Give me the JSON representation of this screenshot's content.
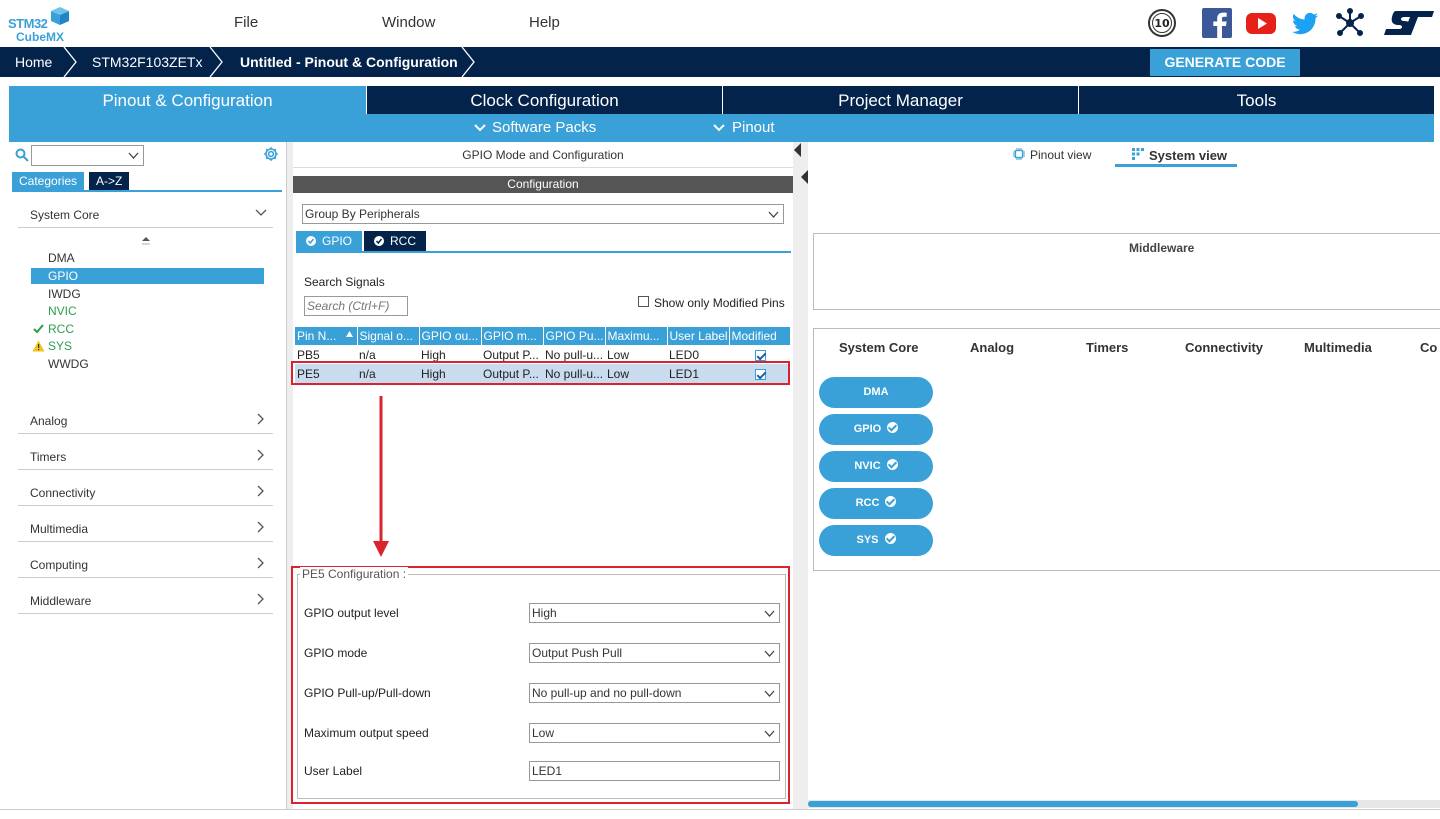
{
  "app": {
    "logo_line1": "STM32",
    "logo_line2": "CubeMX",
    "menu": [
      "File",
      "Window",
      "Help"
    ]
  },
  "social_icons": [
    "anniversary-badge-icon",
    "facebook-icon",
    "youtube-icon",
    "twitter-icon",
    "network-icon",
    "st-logo-icon"
  ],
  "social_badge": "10",
  "breadcrumb": {
    "items": [
      "Home",
      "STM32F103ZETx",
      "Untitled - Pinout & Configuration"
    ],
    "generate_label": "GENERATE CODE"
  },
  "main_tabs": [
    "Pinout & Configuration",
    "Clock Configuration",
    "Project Manager",
    "Tools"
  ],
  "sub_menu": [
    "Software Packs",
    "Pinout"
  ],
  "sidebar": {
    "search_value": "",
    "tabs": [
      "Categories",
      "A->Z"
    ],
    "categories": [
      {
        "label": "System Core",
        "expanded": true
      },
      {
        "label": "Analog"
      },
      {
        "label": "Timers"
      },
      {
        "label": "Connectivity"
      },
      {
        "label": "Multimedia"
      },
      {
        "label": "Computing"
      },
      {
        "label": "Middleware"
      }
    ],
    "system_core_items": [
      {
        "label": "DMA",
        "state": "none"
      },
      {
        "label": "GPIO",
        "state": "selected"
      },
      {
        "label": "IWDG",
        "state": "none"
      },
      {
        "label": "NVIC",
        "state": "green"
      },
      {
        "label": "RCC",
        "state": "ok"
      },
      {
        "label": "SYS",
        "state": "warn"
      },
      {
        "label": "WWDG",
        "state": "none"
      }
    ]
  },
  "middle": {
    "title": "GPIO Mode and Configuration",
    "config_bar": "Configuration",
    "group_by": "Group By Peripherals",
    "peripheral_tabs": [
      "GPIO",
      "RCC"
    ],
    "search_label": "Search Signals",
    "search_placeholder": "Search (Ctrl+F)",
    "show_modified_label": "Show only Modified Pins",
    "table": {
      "headers": [
        "Pin N...",
        "Signal o...",
        "GPIO ou...",
        "GPIO m...",
        "GPIO Pu...",
        "Maximu...",
        "User Label",
        "Modified"
      ],
      "rows": [
        {
          "pin": "PB5",
          "signal": "n/a",
          "output": "High",
          "mode": "Output P...",
          "pull": "No pull-u...",
          "speed": "Low",
          "label": "LED0",
          "modified": true
        },
        {
          "pin": "PE5",
          "signal": "n/a",
          "output": "High",
          "mode": "Output P...",
          "pull": "No pull-u...",
          "speed": "Low",
          "label": "LED1",
          "modified": true
        }
      ]
    },
    "pin_config": {
      "title": "PE5 Configuration :",
      "fields": [
        {
          "label": "GPIO output level",
          "value": "High",
          "type": "select"
        },
        {
          "label": "GPIO mode",
          "value": "Output Push Pull",
          "type": "select"
        },
        {
          "label": "GPIO Pull-up/Pull-down",
          "value": "No pull-up and no pull-down",
          "type": "select"
        },
        {
          "label": "Maximum output speed",
          "value": "Low",
          "type": "select"
        },
        {
          "label": "User Label",
          "value": "LED1",
          "type": "input"
        }
      ]
    }
  },
  "right": {
    "view_tabs": [
      "Pinout view",
      "System view"
    ],
    "middleware_label": "Middleware",
    "columns": [
      "System Core",
      "Analog",
      "Timers",
      "Connectivity",
      "Multimedia",
      "Co"
    ],
    "system_buttons": [
      {
        "label": "DMA",
        "ok": false
      },
      {
        "label": "GPIO",
        "ok": true
      },
      {
        "label": "NVIC",
        "ok": true
      },
      {
        "label": "RCC",
        "ok": true
      },
      {
        "label": "SYS",
        "ok": true
      }
    ]
  },
  "colors": {
    "accent": "#3aa0d8",
    "dark": "#03234b",
    "highlight": "#d9232d"
  }
}
